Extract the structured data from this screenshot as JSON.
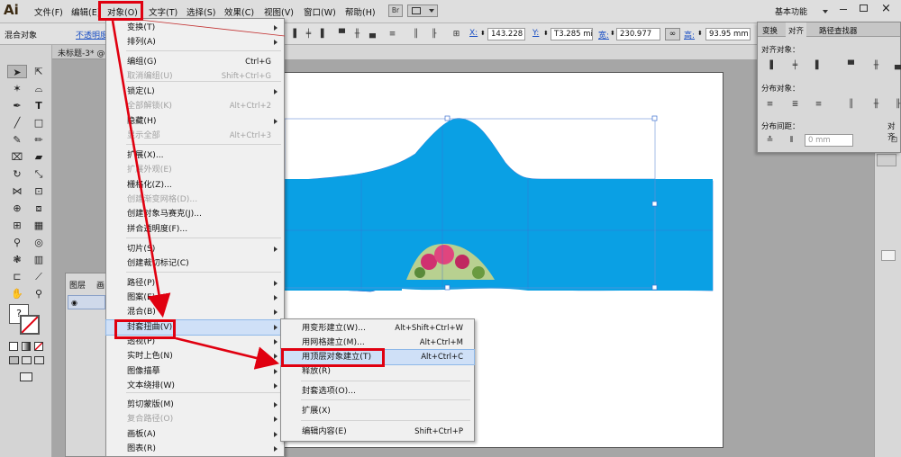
{
  "app": {
    "logo": "Ai",
    "workspace_label": "基本功能"
  },
  "menubar": {
    "items": [
      "文件(F)",
      "编辑(E)",
      "对象(O)",
      "文字(T)",
      "选择(S)",
      "效果(C)",
      "视图(V)",
      "窗口(W)",
      "帮助(H)"
    ],
    "br_label": "Br"
  },
  "control": {
    "mode": "混合对象",
    "opacity_label": "不透明度",
    "x_label": "X:",
    "x_value": "143.228",
    "y_label": "Y:",
    "y_value": "T3.285 mi",
    "w_label": "宽:",
    "w_value": "230.977",
    "h_label": "高:",
    "h_value": "93.95 mm"
  },
  "document": {
    "tab_label": "未标题-3* @"
  },
  "layers": {
    "tab1": "图层",
    "tab2": "画"
  },
  "object_menu": {
    "items": [
      {
        "label": "变换(T)",
        "shortcut": "",
        "submenu": true,
        "disabled": false
      },
      {
        "label": "排列(A)",
        "shortcut": "",
        "submenu": true,
        "disabled": false
      },
      {
        "label": "编组(G)",
        "shortcut": "Ctrl+G",
        "submenu": false,
        "disabled": false
      },
      {
        "label": "取消编组(U)",
        "shortcut": "Shift+Ctrl+G",
        "submenu": false,
        "disabled": true
      },
      {
        "label": "锁定(L)",
        "shortcut": "",
        "submenu": true,
        "disabled": false
      },
      {
        "label": "全部解锁(K)",
        "shortcut": "Alt+Ctrl+2",
        "submenu": false,
        "disabled": true
      },
      {
        "label": "隐藏(H)",
        "shortcut": "",
        "submenu": true,
        "disabled": false
      },
      {
        "label": "显示全部",
        "shortcut": "Alt+Ctrl+3",
        "submenu": false,
        "disabled": true
      },
      {
        "label": "扩展(X)...",
        "shortcut": "",
        "submenu": false,
        "disabled": false
      },
      {
        "label": "扩展外观(E)",
        "shortcut": "",
        "submenu": false,
        "disabled": true
      },
      {
        "label": "栅格化(Z)...",
        "shortcut": "",
        "submenu": false,
        "disabled": false
      },
      {
        "label": "创建渐变网格(D)...",
        "shortcut": "",
        "submenu": false,
        "disabled": true
      },
      {
        "label": "创建对象马赛克(J)...",
        "shortcut": "",
        "submenu": false,
        "disabled": false
      },
      {
        "label": "拼合透明度(F)...",
        "shortcut": "",
        "submenu": false,
        "disabled": false
      },
      {
        "label": "切片(S)",
        "shortcut": "",
        "submenu": true,
        "disabled": false
      },
      {
        "label": "创建裁切标记(C)",
        "shortcut": "",
        "submenu": false,
        "disabled": false
      },
      {
        "label": "路径(P)",
        "shortcut": "",
        "submenu": true,
        "disabled": false
      },
      {
        "label": "图案(E)",
        "shortcut": "",
        "submenu": true,
        "disabled": false
      },
      {
        "label": "混合(B)",
        "shortcut": "",
        "submenu": true,
        "disabled": false
      },
      {
        "label": "封套扭曲(V)",
        "shortcut": "",
        "submenu": true,
        "disabled": false,
        "highlighted": true
      },
      {
        "label": "透视(P)",
        "shortcut": "",
        "submenu": true,
        "disabled": false
      },
      {
        "label": "实时上色(N)",
        "shortcut": "",
        "submenu": true,
        "disabled": false
      },
      {
        "label": "图像描摹",
        "shortcut": "",
        "submenu": true,
        "disabled": false
      },
      {
        "label": "文本绕排(W)",
        "shortcut": "",
        "submenu": true,
        "disabled": false
      },
      {
        "label": "剪切蒙版(M)",
        "shortcut": "",
        "submenu": true,
        "disabled": false
      },
      {
        "label": "复合路径(O)",
        "shortcut": "",
        "submenu": true,
        "disabled": true
      },
      {
        "label": "画板(A)",
        "shortcut": "",
        "submenu": true,
        "disabled": false
      },
      {
        "label": "图表(R)",
        "shortcut": "",
        "submenu": true,
        "disabled": false
      }
    ]
  },
  "envelope_submenu": {
    "items": [
      {
        "label": "用变形建立(W)...",
        "shortcut": "Alt+Shift+Ctrl+W"
      },
      {
        "label": "用网格建立(M)...",
        "shortcut": "Alt+Ctrl+M"
      },
      {
        "label": "用顶层对象建立(T)",
        "shortcut": "Alt+Ctrl+C",
        "highlighted": true
      },
      {
        "label": "释放(R)",
        "shortcut": ""
      },
      {
        "label": "封套选项(O)...",
        "shortcut": ""
      },
      {
        "label": "扩展(X)",
        "shortcut": ""
      },
      {
        "label": "编辑内容(E)",
        "shortcut": "Shift+Ctrl+P"
      }
    ]
  },
  "align_panel": {
    "tabs": [
      "变换",
      "对齐",
      "路径查找器"
    ],
    "align_objects": "对齐对象：",
    "distribute_objects": "分布对象：",
    "distribute_spacing": "分布间距：",
    "spacing_value": "0 mm",
    "align_to": "对齐"
  },
  "colors": {
    "envelope_fill": "#0aa0e4",
    "highlight_red": "#e00010",
    "menu_bg": "#f0f0f0",
    "menu_highlight": "#cfe0f7"
  }
}
